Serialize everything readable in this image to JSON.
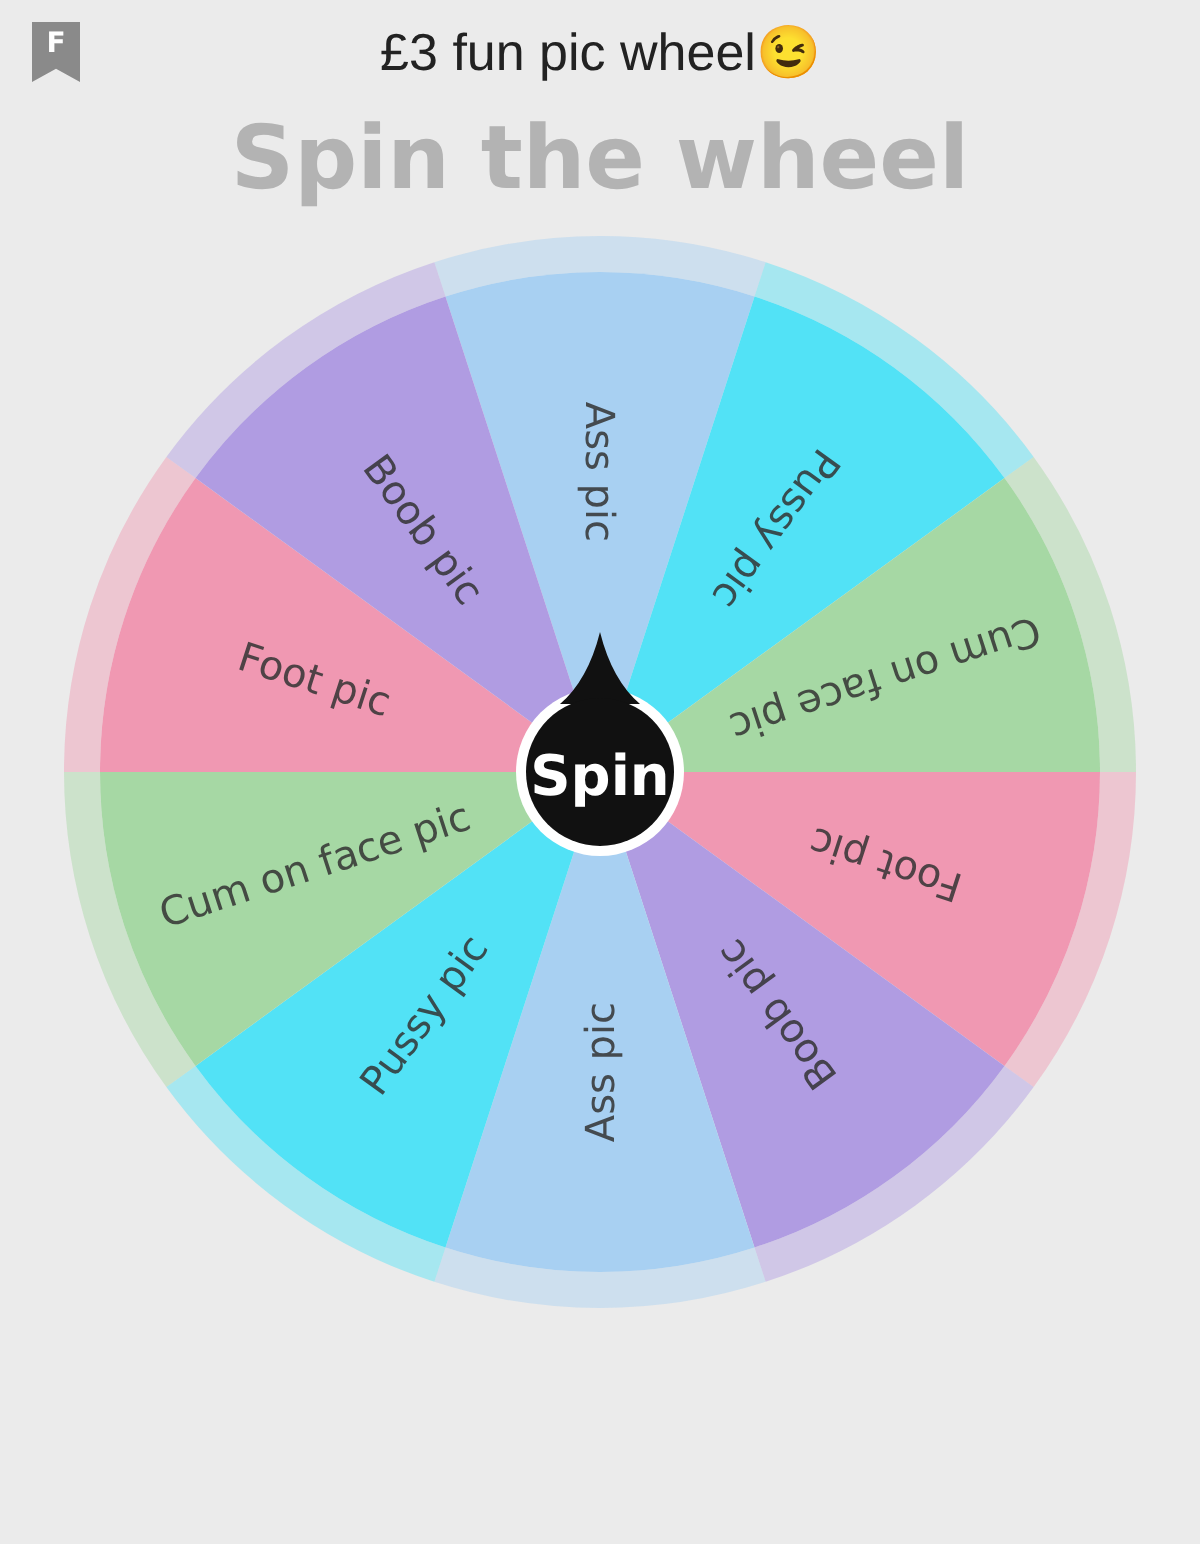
{
  "header": {
    "badge": "F",
    "title": "£3 fun pic wheel😉"
  },
  "heading": "Spin the wheel",
  "wheel": {
    "spin_button": "Spin",
    "segments": [
      {
        "label": "Ass pic",
        "color": "#a8d0f2"
      },
      {
        "label": "Pussy pic",
        "color": "#52e2f6"
      },
      {
        "label": "Cum on face pic",
        "color": "#a6d8a4"
      },
      {
        "label": "Foot pic",
        "color": "#f098b2"
      },
      {
        "label": "Boob pic",
        "color": "#b09ce2"
      },
      {
        "label": "Ass pic",
        "color": "#a8d0f2"
      },
      {
        "label": "Pussy pic",
        "color": "#52e2f6"
      },
      {
        "label": "Cum on face pic",
        "color": "#a6d8a4"
      },
      {
        "label": "Foot pic",
        "color": "#f098b2"
      },
      {
        "label": "Boob pic",
        "color": "#b09ce2"
      }
    ]
  }
}
